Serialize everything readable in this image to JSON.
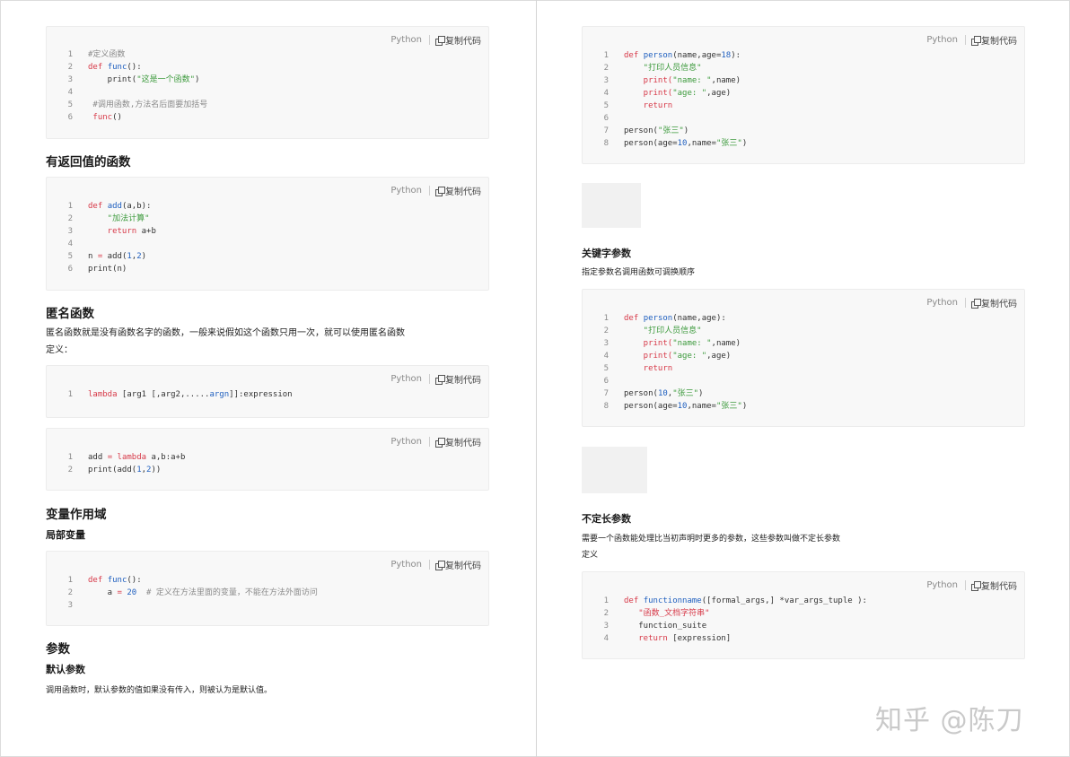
{
  "code_header": {
    "lang": "Python",
    "copy_label": "复制代码"
  },
  "watermark": "知乎 @陈刀",
  "left": {
    "h_return_func": "有返回值的函数",
    "h_anon": "匿名函数",
    "anon_desc": "匿名函数就是没有函数名字的函数，一般来说假如这个函数只用一次，就可以使用匿名函数",
    "anon_def": "定义：",
    "h_scope": "变量作用域",
    "h_local": "局部变量",
    "h_params": "参数",
    "h_default": "默认参数",
    "default_desc": "调用函数时，默认参数的值如果没有传入，则被认为是默认值。"
  },
  "right": {
    "h_keyword": "关键字参数",
    "keyword_desc": "指定参数名调用函数可调换顺序",
    "h_varlen": "不定长参数",
    "varlen_desc": "需要一个函数能处理比当初声明时更多的参数，这些参数叫做不定长参数",
    "varlen_def": "定义"
  },
  "code_blocks": {
    "b1": [
      "1",
      "2",
      "3",
      "4",
      "5",
      "6"
    ],
    "b2": [
      "1",
      "2",
      "3",
      "4",
      "5",
      "6"
    ],
    "b3": [
      "1"
    ],
    "b4": [
      "1",
      "2"
    ],
    "b5": [
      "1",
      "2",
      "3"
    ],
    "b6": [
      "1",
      "2",
      "3",
      "4",
      "5",
      "6",
      "7",
      "8"
    ],
    "b7": [
      "1",
      "2",
      "3",
      "4",
      "5",
      "6",
      "7",
      "8"
    ],
    "b8": [
      "1",
      "2",
      "3",
      "4"
    ]
  },
  "code_text": {
    "b1": {
      "l1": "#定义函数",
      "l2a": "def",
      "l2b": "func",
      "l2c": "():",
      "l3a": "    print(",
      "l3b": "\"这是一个函数\"",
      "l3c": ")",
      "l5": " #调用函数,方法名后面要加括号",
      "l6a": " func",
      "l6b": "()"
    },
    "b2": {
      "l1a": "def",
      "l1b": "add",
      "l1c": "(a,b):",
      "l2": "    \"加法计算\"",
      "l3a": "    return",
      "l3b": " a+b",
      "l5a": "n ",
      "l5b": "=",
      "l5c": " add(",
      "l5d": "1",
      "l5e": ",",
      "l5f": "2",
      "l5g": ")",
      "l6": "print(n)"
    },
    "b3": {
      "l1a": "lambda",
      "l1b": " [arg1 [,arg2,.....",
      "l1c": "argn",
      "l1d": "]]:expression"
    },
    "b4": {
      "l1a": "add ",
      "l1b": "=",
      "l1c": " lambda",
      "l1d": " a,b:a+b",
      "l2a": "print(add(",
      "l2b": "1",
      "l2c": ",",
      "l2d": "2",
      "l2e": "))"
    },
    "b5": {
      "l1a": "def",
      "l1b": "func",
      "l1c": "():",
      "l2a": "    a ",
      "l2b": "=",
      "l2c": " 20",
      "l2d": "  # 定义在方法里面的变量，不能在方法外面访问"
    },
    "b6": {
      "l1a": "def",
      "l1b": "person",
      "l1c": "(name,age=",
      "l1d": "18",
      "l1e": "):",
      "l2": "    \"打印人员信息\"",
      "l3a": "    print(",
      "l3b": "\"name: \"",
      "l3c": ",name)",
      "l4a": "    print(",
      "l4b": "\"age: \"",
      "l4c": ",age)",
      "l5": "    return",
      "l7a": "person(",
      "l7b": "\"张三\"",
      "l7c": ")",
      "l8a": "person(age=",
      "l8b": "10",
      "l8c": ",name=",
      "l8d": "\"张三\"",
      "l8e": ")"
    },
    "b7": {
      "l1a": "def",
      "l1b": "person",
      "l1c": "(name,age):",
      "l2": "    \"打印人员信息\"",
      "l3a": "    print(",
      "l3b": "\"name: \"",
      "l3c": ",name)",
      "l4a": "    print(",
      "l4b": "\"age: \"",
      "l4c": ",age)",
      "l5": "    return",
      "l7a": "person(",
      "l7b": "10",
      "l7c": ",",
      "l7d": "\"张三\"",
      "l7e": ")",
      "l8a": "person(age=",
      "l8b": "10",
      "l8c": ",name=",
      "l8d": "\"张三\"",
      "l8e": ")"
    },
    "b8": {
      "l1a": "def",
      "l1b": "functionname",
      "l1c": "([formal_args,] *var_args_tuple ):",
      "l2": "   \"函数_文档字符串\"",
      "l3": "   function_suite",
      "l4a": "   return",
      "l4b": " [expression]"
    }
  }
}
